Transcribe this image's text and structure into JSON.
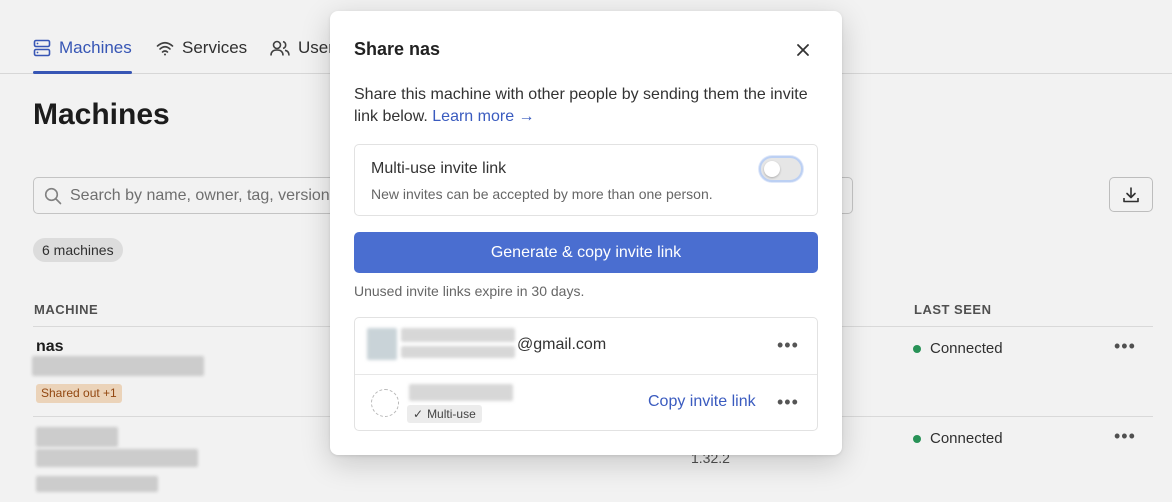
{
  "nav": {
    "tabs": [
      {
        "label": "Machines",
        "icon": "server-icon",
        "active": true
      },
      {
        "label": "Services",
        "icon": "wifi-icon",
        "active": false
      },
      {
        "label": "Users",
        "icon": "users-icon",
        "active": false
      }
    ]
  },
  "page": {
    "title": "Machines",
    "search_placeholder": "Search by name, owner, tag, version",
    "machine_count": "6 machines",
    "columns": {
      "machine": "MACHINE",
      "last_seen": "LAST SEEN"
    },
    "rows": [
      {
        "name": "nas",
        "tag": "Shared out +1",
        "status": "Connected"
      },
      {
        "name": "",
        "version": "1.32.2",
        "status": "Connected"
      }
    ]
  },
  "modal": {
    "title": "Share nas",
    "description": "Share this machine with other people by sending them the invite link below.",
    "learn_more": "Learn more →",
    "multi_use": {
      "title": "Multi-use invite link",
      "subtitle": "New invites can be accepted by more than one person.",
      "enabled": false
    },
    "generate_button": "Generate & copy invite link",
    "expire_note": "Unused invite links expire in 30 days.",
    "invites": [
      {
        "email_suffix": "@gmail.com",
        "more": "•••"
      },
      {
        "badge": "Multi-use",
        "copy_label": "Copy invite link",
        "more": "•••"
      }
    ],
    "close_icon": "close-icon"
  },
  "colors": {
    "accent": "#3a5bbf",
    "button": "#4a6ed0",
    "connected": "#2b9a5c",
    "tag_bg": "#f8dfc3"
  }
}
